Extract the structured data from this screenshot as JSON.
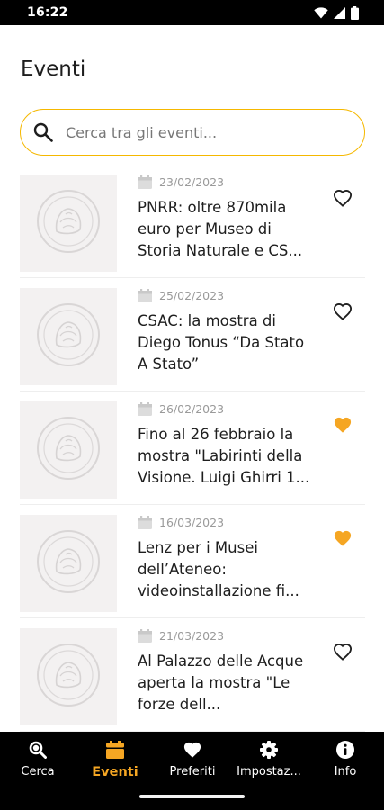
{
  "status_bar": {
    "time": "16:22"
  },
  "page": {
    "title": "Eventi"
  },
  "search": {
    "placeholder": "Cerca tra gli eventi..."
  },
  "colors": {
    "accent": "#f5a623",
    "search_border": "#f5b800",
    "nav_background": "#000000"
  },
  "events": [
    {
      "date": "23/02/2023",
      "title": "PNRR: oltre 870mila euro per Museo di Storia Naturale e CS...",
      "favorite": false
    },
    {
      "date": "25/02/2023",
      "title": "CSAC: la mostra di Diego Tonus “Da Stato A Stato”",
      "favorite": false
    },
    {
      "date": "26/02/2023",
      "title": "Fino al 26 febbraio la mostra \"Labirinti della Visione. Luigi Ghirri 1...",
      "favorite": true
    },
    {
      "date": "16/03/2023",
      "title": "Lenz per i Musei dell’Ateneo: videoinstallazione fi...",
      "favorite": true
    },
    {
      "date": "21/03/2023",
      "title": "Al Palazzo delle Acque aperta la mostra \"Le forze dell...",
      "favorite": false
    }
  ],
  "nav": [
    {
      "label": "Cerca",
      "icon": "search-icon",
      "active": false
    },
    {
      "label": "Eventi",
      "icon": "calendar-icon",
      "active": true
    },
    {
      "label": "Preferiti",
      "icon": "heart-icon",
      "active": false
    },
    {
      "label": "Impostaz...",
      "icon": "gear-icon",
      "active": false
    },
    {
      "label": "Info",
      "icon": "info-icon",
      "active": false
    }
  ]
}
